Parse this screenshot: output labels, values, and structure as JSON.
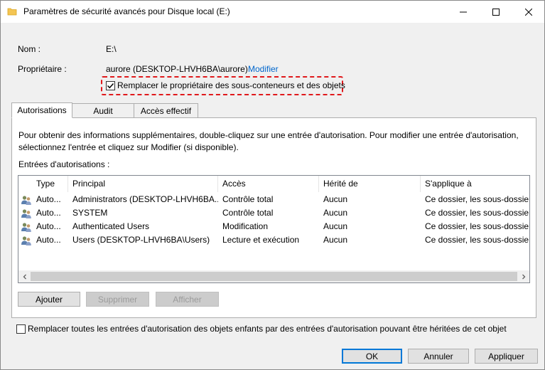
{
  "window": {
    "title": "Paramètres de sécurité avancés pour Disque local (E:)"
  },
  "info": {
    "name_label": "Nom :",
    "name_value": "E:\\",
    "owner_label": "Propriétaire :",
    "owner_value": "aurore (DESKTOP-LHVH6BA\\aurore)",
    "owner_change_link": "Modifier",
    "replace_owner_label": "Remplacer le propriétaire des sous-conteneurs et des objets",
    "replace_owner_checked": true
  },
  "tabs": [
    {
      "label": "Autorisations",
      "active": true
    },
    {
      "label": "Audit",
      "active": false
    },
    {
      "label": "Accès effectif",
      "active": false
    }
  ],
  "permissions": {
    "description": "Pour obtenir des informations supplémentaires, double-cliquez sur une entrée d'autorisation. Pour modifier une entrée d'autorisation, sélectionnez l'entrée et cliquez sur Modifier (si disponible).",
    "entries_label": "Entrées d'autorisations :",
    "columns": [
      "Type",
      "Principal",
      "Accès",
      "Hérité de",
      "S'applique à"
    ],
    "rows": [
      {
        "type": "Auto...",
        "principal": "Administrators (DESKTOP-LHVH6BA...",
        "access": "Contrôle total",
        "inherited": "Aucun",
        "applies": "Ce dossier, les sous-dossiers"
      },
      {
        "type": "Auto...",
        "principal": "SYSTEM",
        "access": "Contrôle total",
        "inherited": "Aucun",
        "applies": "Ce dossier, les sous-dossiers"
      },
      {
        "type": "Auto...",
        "principal": "Authenticated Users",
        "access": "Modification",
        "inherited": "Aucun",
        "applies": "Ce dossier, les sous-dossiers"
      },
      {
        "type": "Auto...",
        "principal": "Users (DESKTOP-LHVH6BA\\Users)",
        "access": "Lecture et exécution",
        "inherited": "Aucun",
        "applies": "Ce dossier, les sous-dossiers"
      }
    ],
    "buttons": {
      "add": "Ajouter",
      "remove": "Supprimer",
      "view": "Afficher"
    }
  },
  "replace_children": {
    "label": "Remplacer toutes les entrées d'autorisation des objets enfants par des entrées d'autorisation pouvant être héritées de cet objet",
    "checked": false
  },
  "dialog_buttons": {
    "ok": "OK",
    "cancel": "Annuler",
    "apply": "Appliquer"
  },
  "colors": {
    "accent": "#0078d7",
    "link": "#0066cc",
    "highlight": "#e0191c"
  },
  "icons": {
    "title": "folder-icon",
    "row": "users-group-icon"
  }
}
